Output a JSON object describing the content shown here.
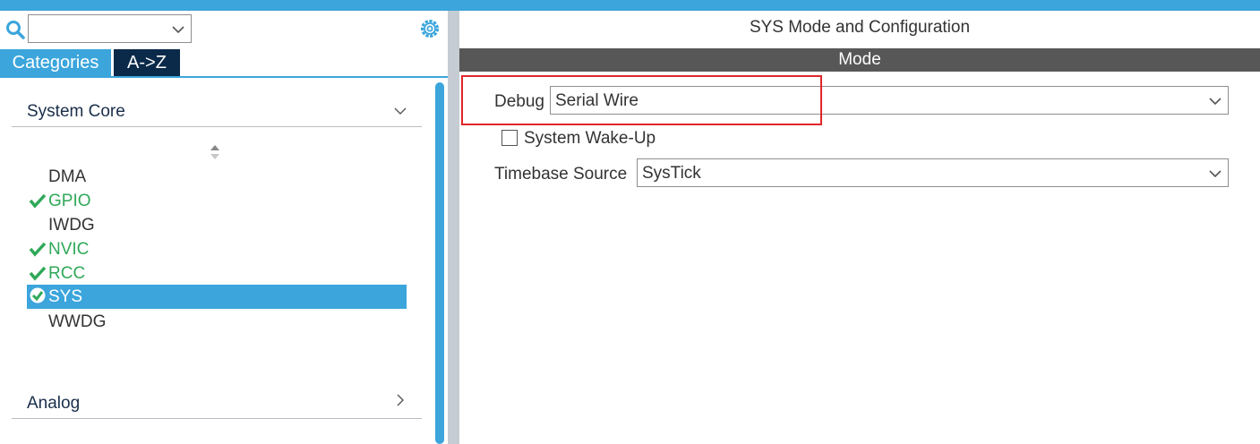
{
  "colors": {
    "accent": "#3ba5dc",
    "dark_tab": "#0b2a4a",
    "check_green": "#2fa858",
    "mode_bar": "#575757",
    "highlight": "#e0262b"
  },
  "left": {
    "search": {
      "value": "",
      "icon": "search-icon"
    },
    "settings_icon": "gear-icon",
    "tabs": {
      "categories": "Categories",
      "az": "A->Z"
    },
    "groups": {
      "system_core": "System Core",
      "analog": "Analog"
    },
    "items": [
      {
        "label": "DMA",
        "checked": false
      },
      {
        "label": "GPIO",
        "checked": true
      },
      {
        "label": "IWDG",
        "checked": false
      },
      {
        "label": "NVIC",
        "checked": true
      },
      {
        "label": "RCC",
        "checked": true
      },
      {
        "label": "SYS",
        "checked": true,
        "selected": true
      },
      {
        "label": "WWDG",
        "checked": false
      }
    ]
  },
  "right": {
    "title": "SYS Mode and Configuration",
    "mode_header": "Mode",
    "debug": {
      "label": "Debug",
      "value": "Serial Wire"
    },
    "wakeup": {
      "label": "System Wake-Up",
      "checked": false
    },
    "timebase": {
      "label": "Timebase Source",
      "value": "SysTick"
    }
  }
}
